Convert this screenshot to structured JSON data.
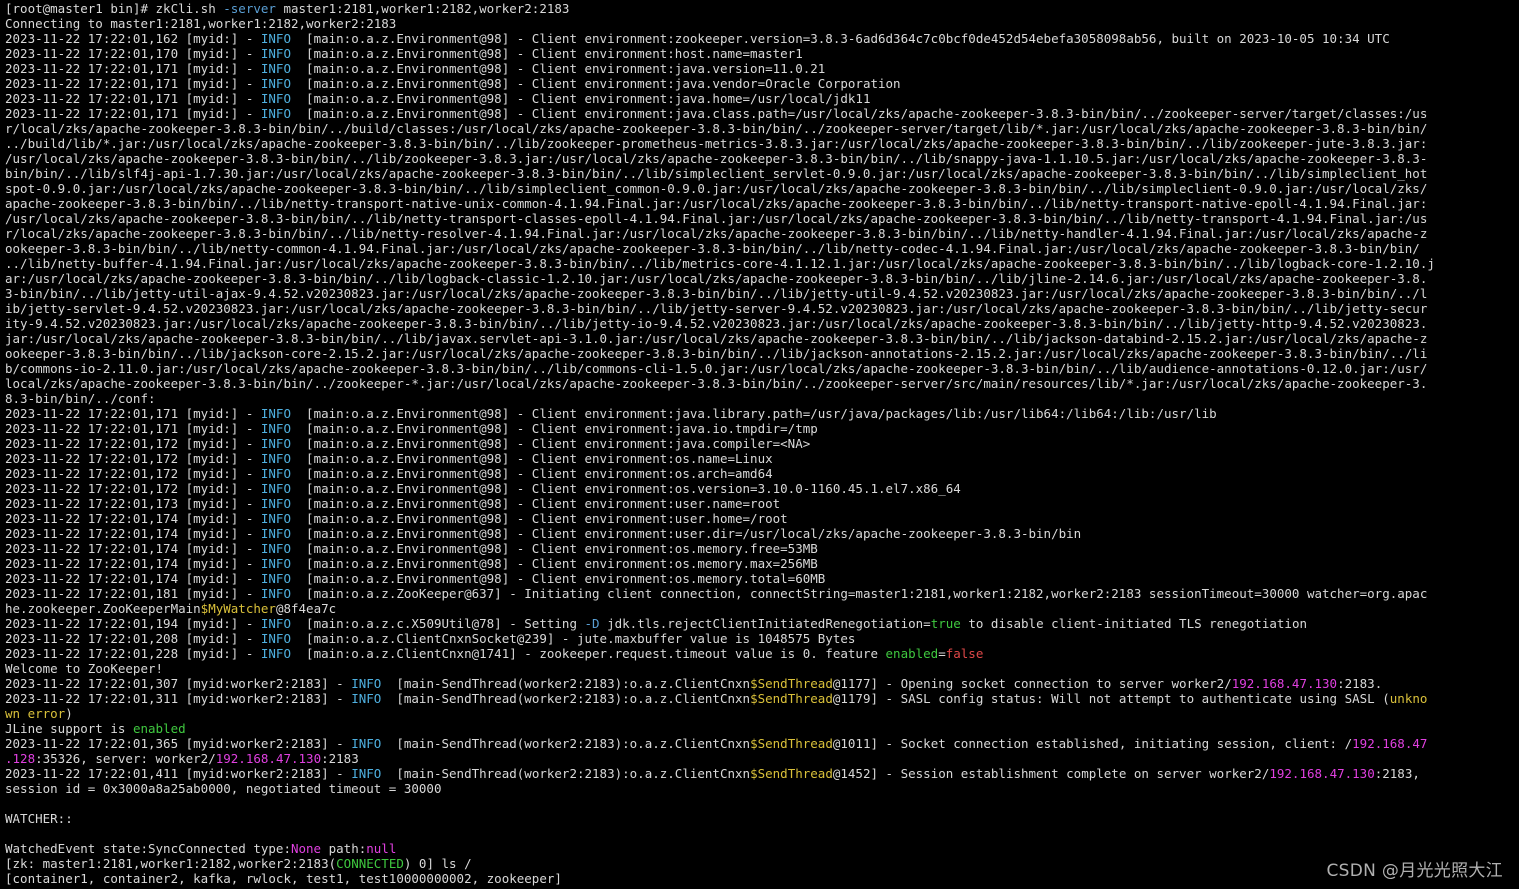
{
  "terminal": {
    "colors": {
      "default": "#d9d9d9",
      "info": "#4fb0e0",
      "option": "#5a9fd4",
      "magenta": "#e040e0",
      "green": "#3fc83f",
      "red": "#e04848",
      "yellow": "#d9c03a"
    },
    "lines": [
      [
        [
          "d",
          "[root@master1 bin]# zkCli.sh "
        ],
        [
          "o",
          "-server"
        ],
        [
          "d",
          " master1:2181,worker1:2182,worker2:2183"
        ]
      ],
      [
        [
          "d",
          "Connecting to master1:2181,worker1:2182,worker2:2183"
        ]
      ],
      [
        [
          "d",
          "2023-11-22 17:22:01,162 [myid:] - "
        ],
        [
          "i",
          "INFO "
        ],
        [
          "d",
          " [main:o.a.z.Environment@98] - Client environment:zookeeper.version=3.8.3-6ad6d364c7c0bcf0de452d54ebefa3058098ab56, built on 2023-10-05 10:34 UTC"
        ]
      ],
      [
        [
          "d",
          "2023-11-22 17:22:01,170 [myid:] - "
        ],
        [
          "i",
          "INFO "
        ],
        [
          "d",
          " [main:o.a.z.Environment@98] - Client environment:host.name=master1"
        ]
      ],
      [
        [
          "d",
          "2023-11-22 17:22:01,171 [myid:] - "
        ],
        [
          "i",
          "INFO "
        ],
        [
          "d",
          " [main:o.a.z.Environment@98] - Client environment:java.version=11.0.21"
        ]
      ],
      [
        [
          "d",
          "2023-11-22 17:22:01,171 [myid:] - "
        ],
        [
          "i",
          "INFO "
        ],
        [
          "d",
          " [main:o.a.z.Environment@98] - Client environment:java.vendor=Oracle Corporation"
        ]
      ],
      [
        [
          "d",
          "2023-11-22 17:22:01,171 [myid:] - "
        ],
        [
          "i",
          "INFO "
        ],
        [
          "d",
          " [main:o.a.z.Environment@98] - Client environment:java.home=/usr/local/jdk11"
        ]
      ],
      [
        [
          "d",
          "2023-11-22 17:22:01,171 [myid:] - "
        ],
        [
          "i",
          "INFO "
        ],
        [
          "d",
          " [main:o.a.z.Environment@98] - Client environment:java.class.path=/usr/local/zks/apache-zookeeper-3.8.3-bin/bin/../zookeeper-server/target/classes:/us"
        ]
      ],
      [
        [
          "d",
          "r/local/zks/apache-zookeeper-3.8.3-bin/bin/../build/classes:/usr/local/zks/apache-zookeeper-3.8.3-bin/bin/../zookeeper-server/target/lib/*.jar:/usr/local/zks/apache-zookeeper-3.8.3-bin/bin/"
        ]
      ],
      [
        [
          "d",
          "../build/lib/*.jar:/usr/local/zks/apache-zookeeper-3.8.3-bin/bin/../lib/zookeeper-prometheus-metrics-3.8.3.jar:/usr/local/zks/apache-zookeeper-3.8.3-bin/bin/../lib/zookeeper-jute-3.8.3.jar:"
        ]
      ],
      [
        [
          "d",
          "/usr/local/zks/apache-zookeeper-3.8.3-bin/bin/../lib/zookeeper-3.8.3.jar:/usr/local/zks/apache-zookeeper-3.8.3-bin/bin/../lib/snappy-java-1.1.10.5.jar:/usr/local/zks/apache-zookeeper-3.8.3-"
        ]
      ],
      [
        [
          "d",
          "bin/bin/../lib/slf4j-api-1.7.30.jar:/usr/local/zks/apache-zookeeper-3.8.3-bin/bin/../lib/simpleclient_servlet-0.9.0.jar:/usr/local/zks/apache-zookeeper-3.8.3-bin/bin/../lib/simpleclient_hot"
        ]
      ],
      [
        [
          "d",
          "spot-0.9.0.jar:/usr/local/zks/apache-zookeeper-3.8.3-bin/bin/../lib/simpleclient_common-0.9.0.jar:/usr/local/zks/apache-zookeeper-3.8.3-bin/bin/../lib/simpleclient-0.9.0.jar:/usr/local/zks/"
        ]
      ],
      [
        [
          "d",
          "apache-zookeeper-3.8.3-bin/bin/../lib/netty-transport-native-unix-common-4.1.94.Final.jar:/usr/local/zks/apache-zookeeper-3.8.3-bin/bin/../lib/netty-transport-native-epoll-4.1.94.Final.jar:"
        ]
      ],
      [
        [
          "d",
          "/usr/local/zks/apache-zookeeper-3.8.3-bin/bin/../lib/netty-transport-classes-epoll-4.1.94.Final.jar:/usr/local/zks/apache-zookeeper-3.8.3-bin/bin/../lib/netty-transport-4.1.94.Final.jar:/us"
        ]
      ],
      [
        [
          "d",
          "r/local/zks/apache-zookeeper-3.8.3-bin/bin/../lib/netty-resolver-4.1.94.Final.jar:/usr/local/zks/apache-zookeeper-3.8.3-bin/bin/../lib/netty-handler-4.1.94.Final.jar:/usr/local/zks/apache-z"
        ]
      ],
      [
        [
          "d",
          "ookeeper-3.8.3-bin/bin/../lib/netty-common-4.1.94.Final.jar:/usr/local/zks/apache-zookeeper-3.8.3-bin/bin/../lib/netty-codec-4.1.94.Final.jar:/usr/local/zks/apache-zookeeper-3.8.3-bin/bin/"
        ]
      ],
      [
        [
          "d",
          "../lib/netty-buffer-4.1.94.Final.jar:/usr/local/zks/apache-zookeeper-3.8.3-bin/bin/../lib/metrics-core-4.1.12.1.jar:/usr/local/zks/apache-zookeeper-3.8.3-bin/bin/../lib/logback-core-1.2.10.j"
        ]
      ],
      [
        [
          "d",
          "ar:/usr/local/zks/apache-zookeeper-3.8.3-bin/bin/../lib/logback-classic-1.2.10.jar:/usr/local/zks/apache-zookeeper-3.8.3-bin/bin/../lib/jline-2.14.6.jar:/usr/local/zks/apache-zookeeper-3.8."
        ]
      ],
      [
        [
          "d",
          "3-bin/bin/../lib/jetty-util-ajax-9.4.52.v20230823.jar:/usr/local/zks/apache-zookeeper-3.8.3-bin/bin/../lib/jetty-util-9.4.52.v20230823.jar:/usr/local/zks/apache-zookeeper-3.8.3-bin/bin/../l"
        ]
      ],
      [
        [
          "d",
          "ib/jetty-servlet-9.4.52.v20230823.jar:/usr/local/zks/apache-zookeeper-3.8.3-bin/bin/../lib/jetty-server-9.4.52.v20230823.jar:/usr/local/zks/apache-zookeeper-3.8.3-bin/bin/../lib/jetty-secur"
        ]
      ],
      [
        [
          "d",
          "ity-9.4.52.v20230823.jar:/usr/local/zks/apache-zookeeper-3.8.3-bin/bin/../lib/jetty-io-9.4.52.v20230823.jar:/usr/local/zks/apache-zookeeper-3.8.3-bin/bin/../lib/jetty-http-9.4.52.v20230823."
        ]
      ],
      [
        [
          "d",
          "jar:/usr/local/zks/apache-zookeeper-3.8.3-bin/bin/../lib/javax.servlet-api-3.1.0.jar:/usr/local/zks/apache-zookeeper-3.8.3-bin/bin/../lib/jackson-databind-2.15.2.jar:/usr/local/zks/apache-z"
        ]
      ],
      [
        [
          "d",
          "ookeeper-3.8.3-bin/bin/../lib/jackson-core-2.15.2.jar:/usr/local/zks/apache-zookeeper-3.8.3-bin/bin/../lib/jackson-annotations-2.15.2.jar:/usr/local/zks/apache-zookeeper-3.8.3-bin/bin/../li"
        ]
      ],
      [
        [
          "d",
          "b/commons-io-2.11.0.jar:/usr/local/zks/apache-zookeeper-3.8.3-bin/bin/../lib/commons-cli-1.5.0.jar:/usr/local/zks/apache-zookeeper-3.8.3-bin/bin/../lib/audience-annotations-0.12.0.jar:/usr/"
        ]
      ],
      [
        [
          "d",
          "local/zks/apache-zookeeper-3.8.3-bin/bin/../zookeeper-*.jar:/usr/local/zks/apache-zookeeper-3.8.3-bin/bin/../zookeeper-server/src/main/resources/lib/*.jar:/usr/local/zks/apache-zookeeper-3."
        ]
      ],
      [
        [
          "d",
          "8.3-bin/bin/../conf:"
        ]
      ],
      [
        [
          "d",
          "2023-11-22 17:22:01,171 [myid:] - "
        ],
        [
          "i",
          "INFO "
        ],
        [
          "d",
          " [main:o.a.z.Environment@98] - Client environment:java.library.path=/usr/java/packages/lib:/usr/lib64:/lib64:/lib:/usr/lib"
        ]
      ],
      [
        [
          "d",
          "2023-11-22 17:22:01,171 [myid:] - "
        ],
        [
          "i",
          "INFO "
        ],
        [
          "d",
          " [main:o.a.z.Environment@98] - Client environment:java.io.tmpdir=/tmp"
        ]
      ],
      [
        [
          "d",
          "2023-11-22 17:22:01,172 [myid:] - "
        ],
        [
          "i",
          "INFO "
        ],
        [
          "d",
          " [main:o.a.z.Environment@98] - Client environment:java.compiler=<NA>"
        ]
      ],
      [
        [
          "d",
          "2023-11-22 17:22:01,172 [myid:] - "
        ],
        [
          "i",
          "INFO "
        ],
        [
          "d",
          " [main:o.a.z.Environment@98] - Client environment:os.name=Linux"
        ]
      ],
      [
        [
          "d",
          "2023-11-22 17:22:01,172 [myid:] - "
        ],
        [
          "i",
          "INFO "
        ],
        [
          "d",
          " [main:o.a.z.Environment@98] - Client environment:os.arch=amd64"
        ]
      ],
      [
        [
          "d",
          "2023-11-22 17:22:01,172 [myid:] - "
        ],
        [
          "i",
          "INFO "
        ],
        [
          "d",
          " [main:o.a.z.Environment@98] - Client environment:os.version=3.10.0-1160.45.1.el7.x86_64"
        ]
      ],
      [
        [
          "d",
          "2023-11-22 17:22:01,173 [myid:] - "
        ],
        [
          "i",
          "INFO "
        ],
        [
          "d",
          " [main:o.a.z.Environment@98] - Client environment:user.name=root"
        ]
      ],
      [
        [
          "d",
          "2023-11-22 17:22:01,174 [myid:] - "
        ],
        [
          "i",
          "INFO "
        ],
        [
          "d",
          " [main:o.a.z.Environment@98] - Client environment:user.home=/root"
        ]
      ],
      [
        [
          "d",
          "2023-11-22 17:22:01,174 [myid:] - "
        ],
        [
          "i",
          "INFO "
        ],
        [
          "d",
          " [main:o.a.z.Environment@98] - Client environment:user.dir=/usr/local/zks/apache-zookeeper-3.8.3-bin/bin"
        ]
      ],
      [
        [
          "d",
          "2023-11-22 17:22:01,174 [myid:] - "
        ],
        [
          "i",
          "INFO "
        ],
        [
          "d",
          " [main:o.a.z.Environment@98] - Client environment:os.memory.free=53MB"
        ]
      ],
      [
        [
          "d",
          "2023-11-22 17:22:01,174 [myid:] - "
        ],
        [
          "i",
          "INFO "
        ],
        [
          "d",
          " [main:o.a.z.Environment@98] - Client environment:os.memory.max=256MB"
        ]
      ],
      [
        [
          "d",
          "2023-11-22 17:22:01,174 [myid:] - "
        ],
        [
          "i",
          "INFO "
        ],
        [
          "d",
          " [main:o.a.z.Environment@98] - Client environment:os.memory.total=60MB"
        ]
      ],
      [
        [
          "d",
          "2023-11-22 17:22:01,181 [myid:] - "
        ],
        [
          "i",
          "INFO "
        ],
        [
          "d",
          " [main:o.a.z.ZooKeeper@637] - Initiating client connection, connectString=master1:2181,worker1:2182,worker2:2183 sessionTimeout=30000 watcher=org.apac"
        ]
      ],
      [
        [
          "d",
          "he.zookeeper.ZooKeeperMain"
        ],
        [
          "y",
          "$MyWatcher"
        ],
        [
          "d",
          "@8f4ea7c"
        ]
      ],
      [
        [
          "d",
          "2023-11-22 17:22:01,194 [myid:] - "
        ],
        [
          "i",
          "INFO "
        ],
        [
          "d",
          " [main:o.a.z.c.X509Util@78] - Setting "
        ],
        [
          "o",
          "-D"
        ],
        [
          "d",
          " jdk.tls.rejectClientInitiatedRenegotiation="
        ],
        [
          "g",
          "true"
        ],
        [
          "d",
          " to disable client-initiated TLS renegotiation"
        ]
      ],
      [
        [
          "d",
          "2023-11-22 17:22:01,208 [myid:] - "
        ],
        [
          "i",
          "INFO "
        ],
        [
          "d",
          " [main:o.a.z.ClientCnxnSocket@239] - jute.maxbuffer value is 1048575 Bytes"
        ]
      ],
      [
        [
          "d",
          "2023-11-22 17:22:01,228 [myid:] - "
        ],
        [
          "i",
          "INFO "
        ],
        [
          "d",
          " [main:o.a.z.ClientCnxn@1741] - zookeeper.request.timeout value is 0. feature "
        ],
        [
          "g",
          "enabled"
        ],
        [
          "d",
          "="
        ],
        [
          "r",
          "false"
        ]
      ],
      [
        [
          "d",
          "Welcome to ZooKeeper!"
        ]
      ],
      [
        [
          "d",
          "2023-11-22 17:22:01,307 [myid:worker2:2183] - "
        ],
        [
          "i",
          "INFO "
        ],
        [
          "d",
          " [main-SendThread(worker2:2183):o.a.z.ClientCnxn"
        ],
        [
          "y",
          "$SendThread"
        ],
        [
          "d",
          "@1177] - Opening socket connection to server worker2/"
        ],
        [
          "m",
          "192.168.47.130"
        ],
        [
          "d",
          ":2183."
        ]
      ],
      [
        [
          "d",
          "2023-11-22 17:22:01,311 [myid:worker2:2183] - "
        ],
        [
          "i",
          "INFO "
        ],
        [
          "d",
          " [main-SendThread(worker2:2183):o.a.z.ClientCnxn"
        ],
        [
          "y",
          "$SendThread"
        ],
        [
          "d",
          "@1179] - SASL config status: Will not attempt to authenticate using SASL ("
        ],
        [
          "y",
          "unkno"
        ]
      ],
      [
        [
          "y",
          "wn error"
        ],
        [
          "d",
          ")"
        ]
      ],
      [
        [
          "d",
          "JLine support is "
        ],
        [
          "g",
          "enabled"
        ]
      ],
      [
        [
          "d",
          "2023-11-22 17:22:01,365 [myid:worker2:2183] - "
        ],
        [
          "i",
          "INFO "
        ],
        [
          "d",
          " [main-SendThread(worker2:2183):o.a.z.ClientCnxn"
        ],
        [
          "y",
          "$SendThread"
        ],
        [
          "d",
          "@1011] - Socket connection established, initiating session, client: /"
        ],
        [
          "m",
          "192.168.47"
        ]
      ],
      [
        [
          "m",
          ".128"
        ],
        [
          "d",
          ":35326, server: worker2/"
        ],
        [
          "m",
          "192.168.47.130"
        ],
        [
          "d",
          ":2183"
        ]
      ],
      [
        [
          "d",
          "2023-11-22 17:22:01,411 [myid:worker2:2183] - "
        ],
        [
          "i",
          "INFO "
        ],
        [
          "d",
          " [main-SendThread(worker2:2183):o.a.z.ClientCnxn"
        ],
        [
          "y",
          "$SendThread"
        ],
        [
          "d",
          "@1452] - Session establishment complete on server worker2/"
        ],
        [
          "m",
          "192.168.47.130"
        ],
        [
          "d",
          ":2183,"
        ]
      ],
      [
        [
          "d",
          "session id = 0x3000a8a25ab0000, negotiated timeout = 30000"
        ]
      ],
      [
        [
          "d",
          ""
        ]
      ],
      [
        [
          "d",
          "WATCHER::"
        ]
      ],
      [
        [
          "d",
          ""
        ]
      ],
      [
        [
          "d",
          "WatchedEvent state:SyncConnected type:"
        ],
        [
          "m",
          "None"
        ],
        [
          "d",
          " path:"
        ],
        [
          "m",
          "null"
        ]
      ],
      [
        [
          "d",
          "[zk: master1:2181,worker1:2182,worker2:2183("
        ],
        [
          "g",
          "CONNECTED"
        ],
        [
          "d",
          ") 0] ls /"
        ]
      ],
      [
        [
          "d",
          "[container1, container2, kafka, rwlock, test1, test10000000002, zookeeper]"
        ]
      ]
    ]
  },
  "watermark": {
    "text": "CSDN @月光光照大江"
  }
}
